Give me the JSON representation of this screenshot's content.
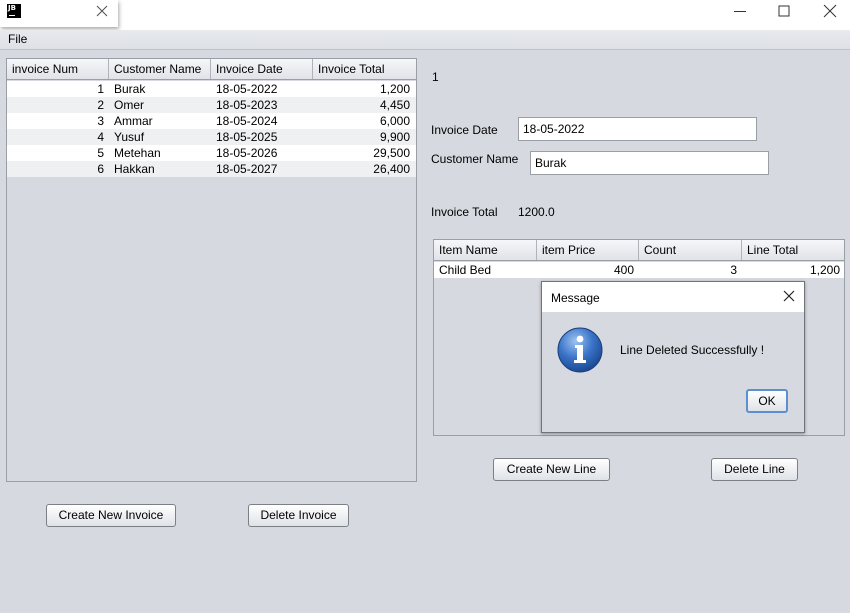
{
  "window": {
    "icon_text": "JB",
    "icons": {
      "close": "close-icon",
      "minimize": "minimize-icon",
      "maximize": "maximize-icon"
    }
  },
  "menu": {
    "file": "File"
  },
  "invoices_table": {
    "columns": [
      "invoice Num",
      "Customer Name",
      "Invoice Date",
      "Invoice Total"
    ],
    "rows": [
      [
        "1",
        "Burak",
        "18-05-2022",
        "1,200"
      ],
      [
        "2",
        "Omer",
        "18-05-2023",
        "4,450"
      ],
      [
        "3",
        "Ammar",
        "18-05-2024",
        "6,000"
      ],
      [
        "4",
        "Yusuf",
        "18-05-2025",
        "9,900"
      ],
      [
        "5",
        "Metehan",
        "18-05-2026",
        "29,500"
      ],
      [
        "6",
        "Hakkan",
        "18-05-2027",
        "26,400"
      ]
    ]
  },
  "left_buttons": {
    "create": "Create New Invoice",
    "delete": "Delete Invoice"
  },
  "details": {
    "invoice_number": "1",
    "date_label": "Invoice Date",
    "date_value": "18-05-2022",
    "customer_label": "Customer Name",
    "customer_value": "Burak",
    "total_label": "Invoice Total",
    "total_value": "1200.0"
  },
  "lines_table": {
    "columns": [
      "Item Name",
      "item Price",
      "Count",
      "Line Total"
    ],
    "rows": [
      [
        "Child Bed",
        "400",
        "3",
        "1,200"
      ]
    ]
  },
  "right_buttons": {
    "create": "Create New Line",
    "delete": "Delete Line"
  },
  "dialog": {
    "title": "Message",
    "message": "Line Deleted Successfully !",
    "ok": "OK",
    "icon": "info-icon"
  }
}
